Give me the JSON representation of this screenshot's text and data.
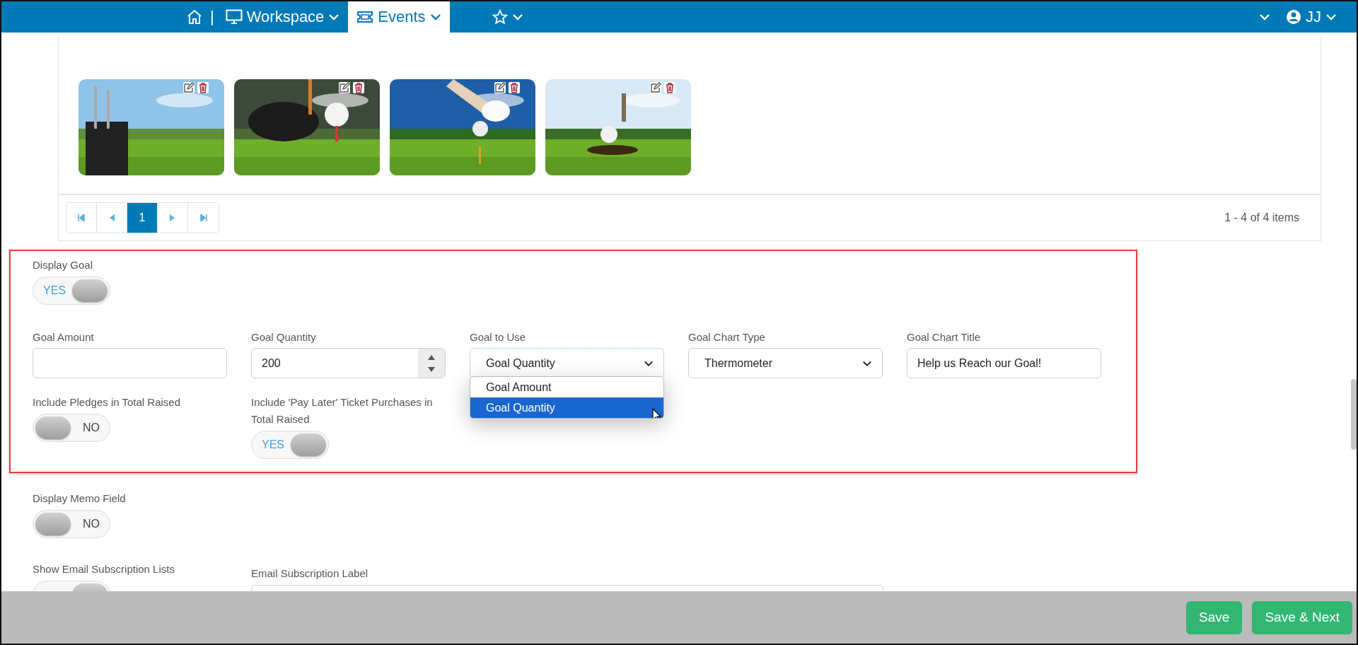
{
  "nav": {
    "separator": "|",
    "tabs": [
      {
        "kind": "workspace",
        "label": "Workspace",
        "selected": false
      },
      {
        "kind": "events",
        "label": "Events",
        "selected": true
      },
      {
        "kind": "favorites",
        "selected": false
      }
    ],
    "user": {
      "initials": "JJ"
    }
  },
  "gallery": {
    "pager": {
      "pages": [
        {
          "label": "1",
          "selected": true
        }
      ],
      "summary": "1 - 4 of 4 items"
    }
  },
  "goal_section": {
    "display_goal": {
      "label": "Display Goal",
      "on": true,
      "text": "YES"
    },
    "fields": [
      {
        "kind": "text",
        "label": "Goal Amount"
      },
      {
        "kind": "number",
        "label": "Goal Quantity",
        "value": "200"
      },
      {
        "kind": "select",
        "label": "Goal to Use",
        "value": "Goal Quantity",
        "open": true,
        "options": [
          {
            "label": "Goal Amount",
            "selected": false
          },
          {
            "label": "Goal Quantity",
            "selected": true
          }
        ]
      },
      {
        "kind": "select",
        "label": "Goal Chart Type",
        "value": "Thermometer",
        "open": false
      },
      {
        "kind": "text",
        "label": "Goal Chart Title",
        "value": "Help us Reach our Goal!"
      }
    ],
    "include_pledges": {
      "label": "Include Pledges in Total Raised",
      "on": false,
      "text": "NO"
    },
    "include_pay_later": {
      "label": "Include 'Pay Later' Ticket Purchases in Total Raised",
      "on": true,
      "text": "YES"
    }
  },
  "memo": {
    "label": "Display Memo Field",
    "on": false,
    "text": "NO"
  },
  "email_lists": {
    "label": "Show Email Subscription Lists",
    "on": true
  },
  "email_label": {
    "label": "Email Subscription Label"
  },
  "footer": {
    "buttons": [
      "Save",
      "Save & Next"
    ]
  }
}
